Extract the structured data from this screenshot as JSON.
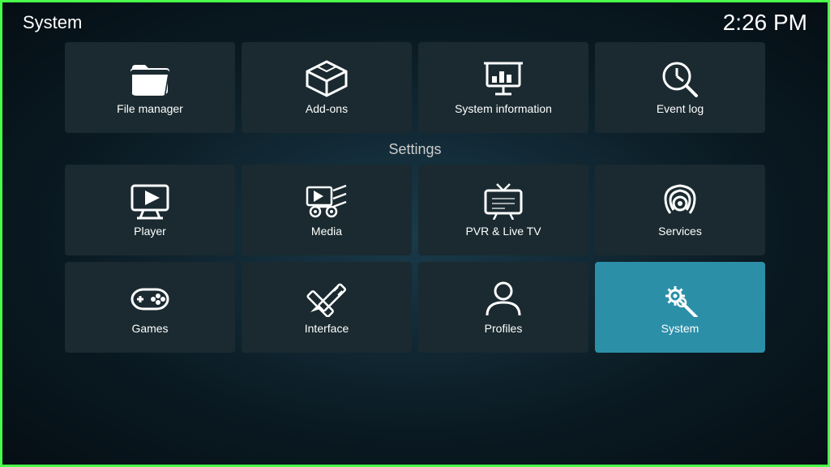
{
  "header": {
    "title": "System",
    "time": "2:26 PM"
  },
  "topRow": [
    {
      "id": "file-manager",
      "label": "File manager",
      "icon": "folder"
    },
    {
      "id": "add-ons",
      "label": "Add-ons",
      "icon": "box"
    },
    {
      "id": "system-information",
      "label": "System information",
      "icon": "presentation"
    },
    {
      "id": "event-log",
      "label": "Event log",
      "icon": "clock-search"
    }
  ],
  "settingsLabel": "Settings",
  "settingsRow1": [
    {
      "id": "player",
      "label": "Player",
      "icon": "monitor-play"
    },
    {
      "id": "media",
      "label": "Media",
      "icon": "media"
    },
    {
      "id": "pvr-live-tv",
      "label": "PVR & Live TV",
      "icon": "tv"
    },
    {
      "id": "services",
      "label": "Services",
      "icon": "podcast"
    }
  ],
  "settingsRow2": [
    {
      "id": "games",
      "label": "Games",
      "icon": "gamepad"
    },
    {
      "id": "interface",
      "label": "Interface",
      "icon": "pencil-ruler"
    },
    {
      "id": "profiles",
      "label": "Profiles",
      "icon": "person"
    },
    {
      "id": "system",
      "label": "System",
      "icon": "gear-wrench",
      "active": true
    }
  ]
}
